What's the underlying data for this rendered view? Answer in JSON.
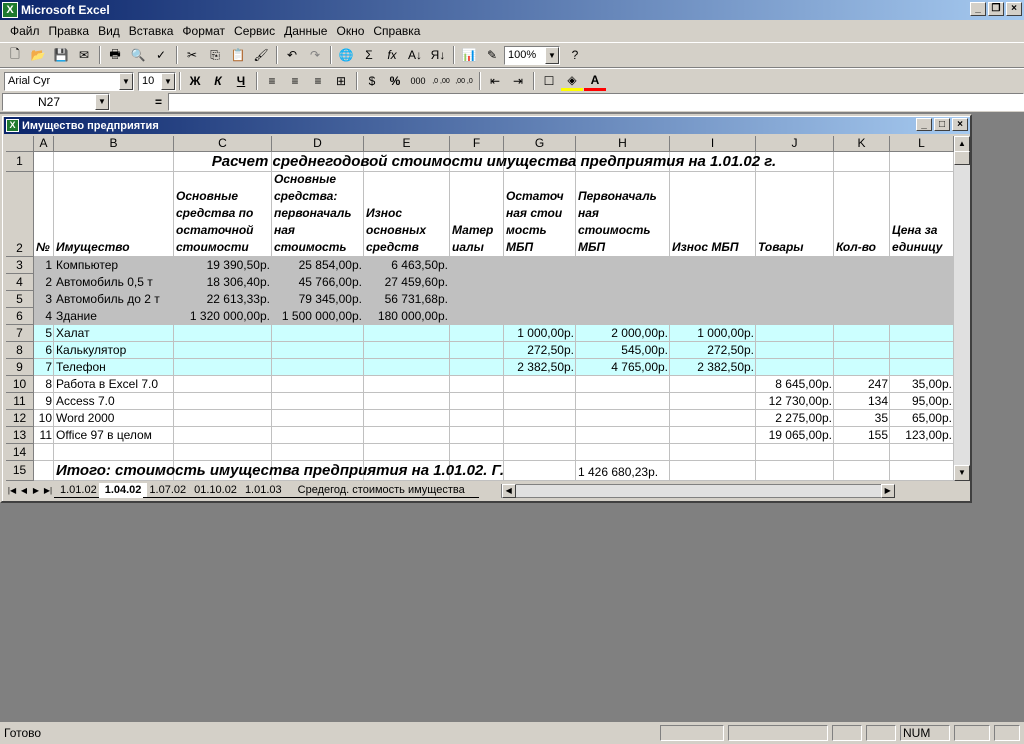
{
  "app": {
    "title": "Microsoft Excel"
  },
  "menu": [
    "Файл",
    "Правка",
    "Вид",
    "Вставка",
    "Формат",
    "Сервис",
    "Данные",
    "Окно",
    "Справка"
  ],
  "toolbar": {
    "zoom": "100%",
    "font": "Arial Cyr",
    "size": "10",
    "bold": "Ж",
    "italic": "К",
    "underline": "Ч",
    "percent": "%",
    "thousands": "000",
    "autosum": "Σ",
    "fx": "fx",
    "inc_dec": ",0 ,00",
    "dec_dec": ",00 ,0",
    "currency_sym": "$"
  },
  "formula_bar": {
    "name_box": "N27",
    "eq": "=",
    "value": ""
  },
  "workbook": {
    "title": "Имущество предприятия"
  },
  "columns": [
    "A",
    "B",
    "C",
    "D",
    "E",
    "F",
    "G",
    "H",
    "I",
    "J",
    "K",
    "L"
  ],
  "rows": [
    "1",
    "2",
    "3",
    "4",
    "5",
    "6",
    "7",
    "8",
    "9",
    "10",
    "11",
    "12",
    "13",
    "14",
    "15"
  ],
  "sheet": {
    "title": "Расчет среднегодовой стоимости имущества предприятия на 1.01.02 г.",
    "headers": {
      "A": "№",
      "B": "Имущество",
      "C": [
        "Основные",
        "средства по",
        "остаточной",
        "стоимости"
      ],
      "D": [
        "Основные",
        "средства:",
        "первоначаль",
        "ная",
        "стоимость"
      ],
      "E": [
        "Износ",
        "основных",
        "средств"
      ],
      "F": [
        "Матер",
        "иалы"
      ],
      "G": [
        "Остаточ",
        "ная стои",
        "мость",
        "МБП"
      ],
      "H": [
        "Первоначаль",
        "ная",
        "стоимость",
        "МБП"
      ],
      "I": [
        "Износ МБП"
      ],
      "J": [
        "Товары"
      ],
      "K": [
        "Кол-во"
      ],
      "L": [
        "Цена за",
        "единицу"
      ]
    },
    "data": [
      {
        "n": "1",
        "name": "Компьютер",
        "c": "19 390,50р.",
        "d": "25 854,00р.",
        "e": "6 463,50р.",
        "g": "",
        "h": "",
        "i": "",
        "j": "",
        "k": "",
        "l": ""
      },
      {
        "n": "2",
        "name": "Автомобиль 0,5 т",
        "c": "18 306,40р.",
        "d": "45 766,00р.",
        "e": "27 459,60р.",
        "g": "",
        "h": "",
        "i": "",
        "j": "",
        "k": "",
        "l": ""
      },
      {
        "n": "3",
        "name": "Автомобиль до 2 т",
        "c": "22 613,33р.",
        "d": "79 345,00р.",
        "e": "56 731,68р.",
        "g": "",
        "h": "",
        "i": "",
        "j": "",
        "k": "",
        "l": ""
      },
      {
        "n": "4",
        "name": "Здание",
        "c": "1 320 000,00р.",
        "d": "1 500 000,00р.",
        "e": "180 000,00р.",
        "g": "",
        "h": "",
        "i": "",
        "j": "",
        "k": "",
        "l": ""
      },
      {
        "n": "5",
        "name": "Халат",
        "c": "",
        "d": "",
        "e": "",
        "g": "1 000,00р.",
        "h": "2 000,00р.",
        "i": "1 000,00р.",
        "j": "",
        "k": "",
        "l": ""
      },
      {
        "n": "6",
        "name": "Калькулятор",
        "c": "",
        "d": "",
        "e": "",
        "g": "272,50р.",
        "h": "545,00р.",
        "i": "272,50р.",
        "j": "",
        "k": "",
        "l": ""
      },
      {
        "n": "7",
        "name": "Телефон",
        "c": "",
        "d": "",
        "e": "",
        "g": "2 382,50р.",
        "h": "4 765,00р.",
        "i": "2 382,50р.",
        "j": "",
        "k": "",
        "l": ""
      },
      {
        "n": "8",
        "name": "Работа в Excel 7.0",
        "c": "",
        "d": "",
        "e": "",
        "g": "",
        "h": "",
        "i": "",
        "j": "8 645,00р.",
        "k": "247",
        "l": "35,00р."
      },
      {
        "n": "9",
        "name": "Access 7.0",
        "c": "",
        "d": "",
        "e": "",
        "g": "",
        "h": "",
        "i": "",
        "j": "12 730,00р.",
        "k": "134",
        "l": "95,00р."
      },
      {
        "n": "10",
        "name": "Word 2000",
        "c": "",
        "d": "",
        "e": "",
        "g": "",
        "h": "",
        "i": "",
        "j": "2 275,00р.",
        "k": "35",
        "l": "65,00р."
      },
      {
        "n": "11",
        "name": "Office 97 в целом",
        "c": "",
        "d": "",
        "e": "",
        "g": "",
        "h": "",
        "i": "",
        "j": "19 065,00р.",
        "k": "155",
        "l": "123,00р."
      }
    ],
    "total_label": "Итого: стоимость имущества предприятия на 1.01.02. Г.",
    "total_value": "1 426 680,23р."
  },
  "tabs": [
    "1.01.02",
    "1.04.02",
    "1.07.02",
    "01.10.02",
    "1.01.03",
    "Средегод. стоимость имущества"
  ],
  "active_tab": "1.04.02",
  "status": {
    "text": "Готово",
    "num": "NUM"
  },
  "colors": {
    "gray_fill": "#c0c0c0",
    "cyan_fill": "#ccffff",
    "title_blue": "#0a246a"
  }
}
